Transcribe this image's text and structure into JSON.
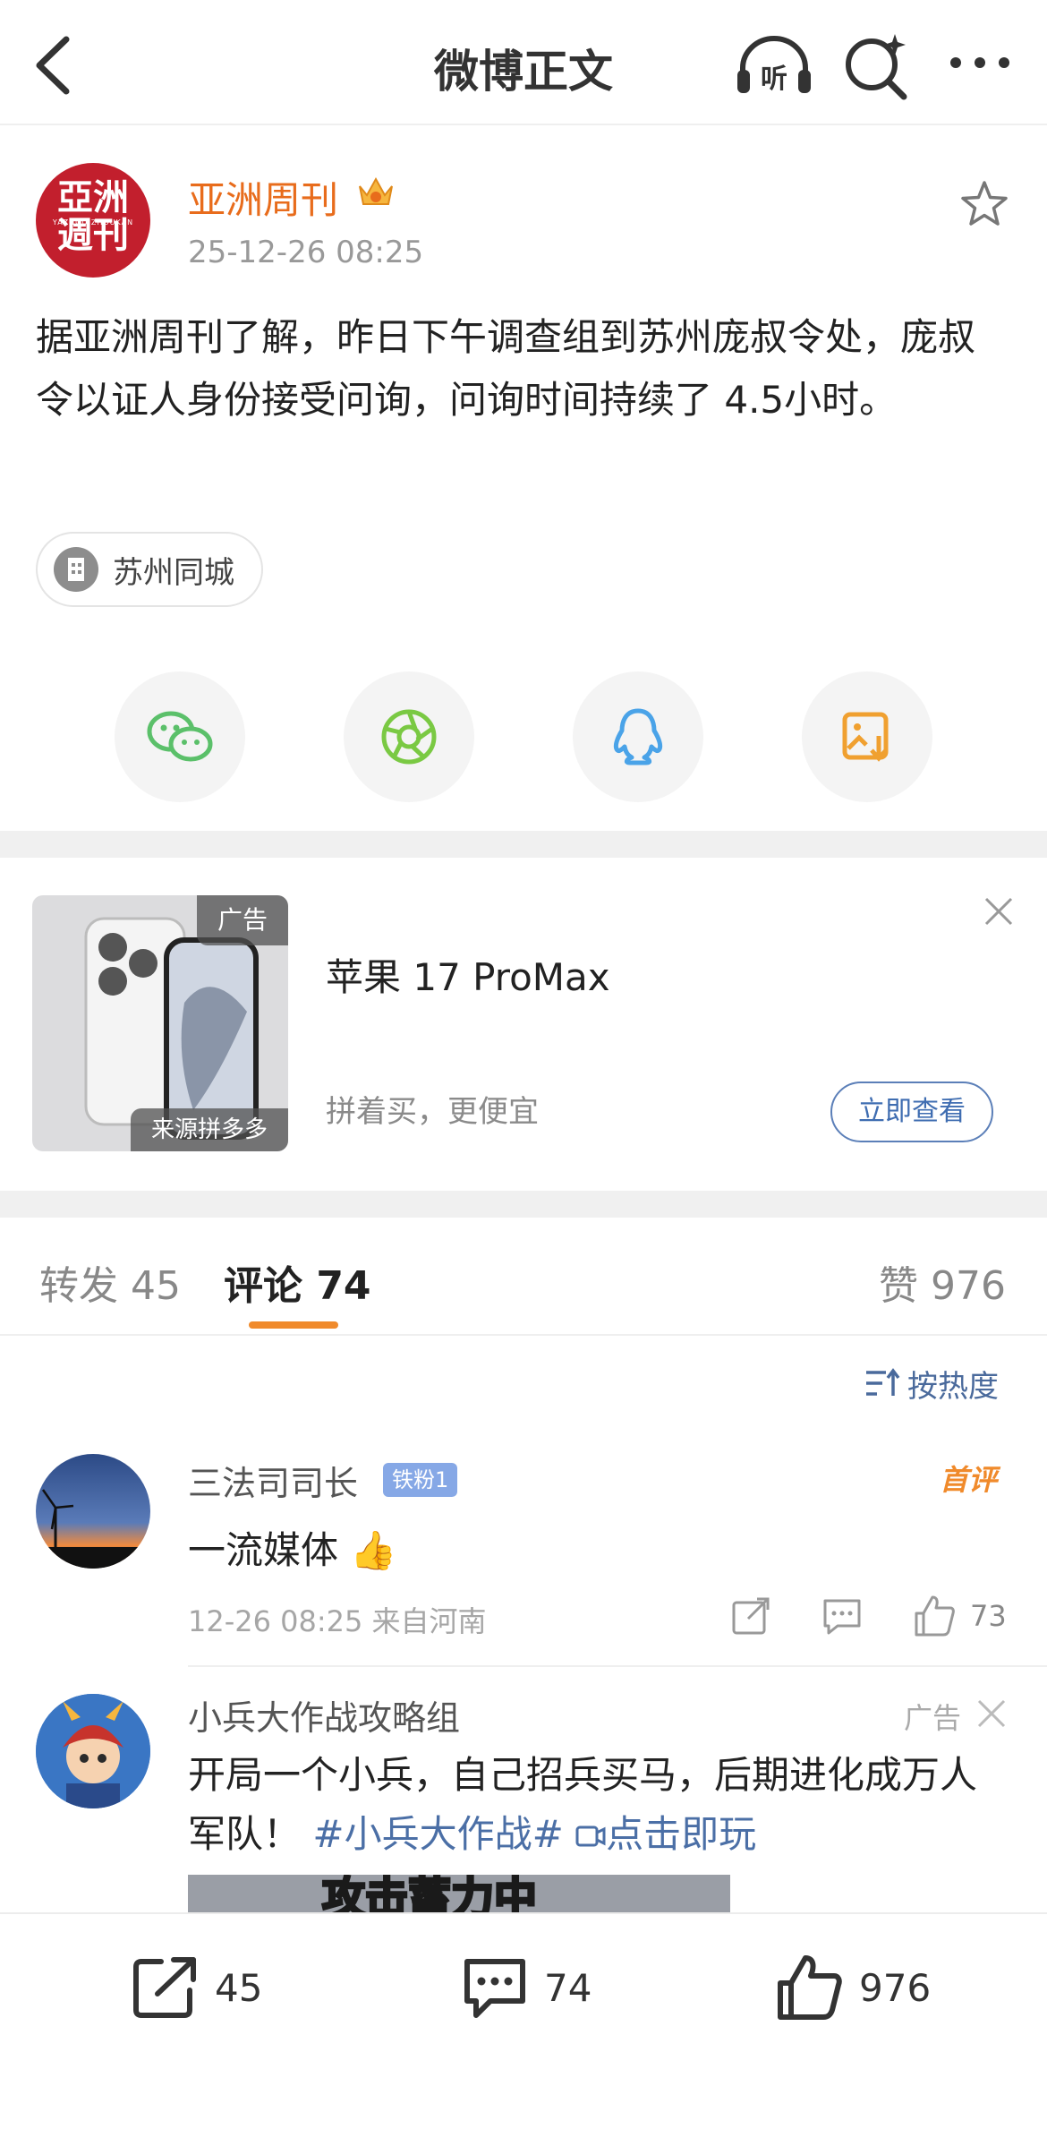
{
  "nav": {
    "title": "微博正文",
    "back_icon": "chevron-left-icon",
    "listen_label": "听",
    "search_icon": "search-sparkle-icon",
    "more_icon": "more-dots-icon"
  },
  "post": {
    "author": "亚洲周刊",
    "avatar_text": "亞洲週刊",
    "avatar_sub": "YAZHOU ZHOUKAN",
    "timestamp": "25-12-26 08:25",
    "content": "据亚洲周刊了解，昨日下午调查组到苏州庞叔令处，庞叔令以证人身份接受问询，问询时间持续了 4.5小时。",
    "location": "苏州同城"
  },
  "share": {
    "items": [
      "wechat-icon",
      "moments-icon",
      "qq-icon",
      "save-image-icon"
    ]
  },
  "ad": {
    "tag": "广告",
    "source": "来源拼多多",
    "title": "苹果 17 ProMax",
    "subtitle": "拼着买，更便宜",
    "button": "立即查看"
  },
  "tabs": {
    "reposts": "转发 45",
    "comments": "评论 74",
    "likes": "赞 976"
  },
  "sort": {
    "label": "按热度"
  },
  "comment": {
    "name": "三法司司长",
    "badge": "铁粉1",
    "first_tag": "首评",
    "text": "一流媒体 👍",
    "meta": "12-26 08:25  来自河南",
    "likes": "73"
  },
  "ad_comment": {
    "name": "小兵大作战攻略组",
    "tag": "广告",
    "text_main": "开局一个小兵，自己招兵买马，后期进化成万人军队！",
    "topic": "#小兵大作战#",
    "link": "点击即玩",
    "image_text": "攻击蓄力中"
  },
  "bottom": {
    "reposts": "45",
    "comments": "74",
    "likes": "976"
  },
  "colors": {
    "accent_orange": "#e86c1c",
    "link_blue": "#4b6fa6",
    "tab_underline": "#f08a2b",
    "wechat_green": "#5bc06a",
    "qq_blue": "#4aa3e8",
    "save_orange": "#f0a030"
  }
}
